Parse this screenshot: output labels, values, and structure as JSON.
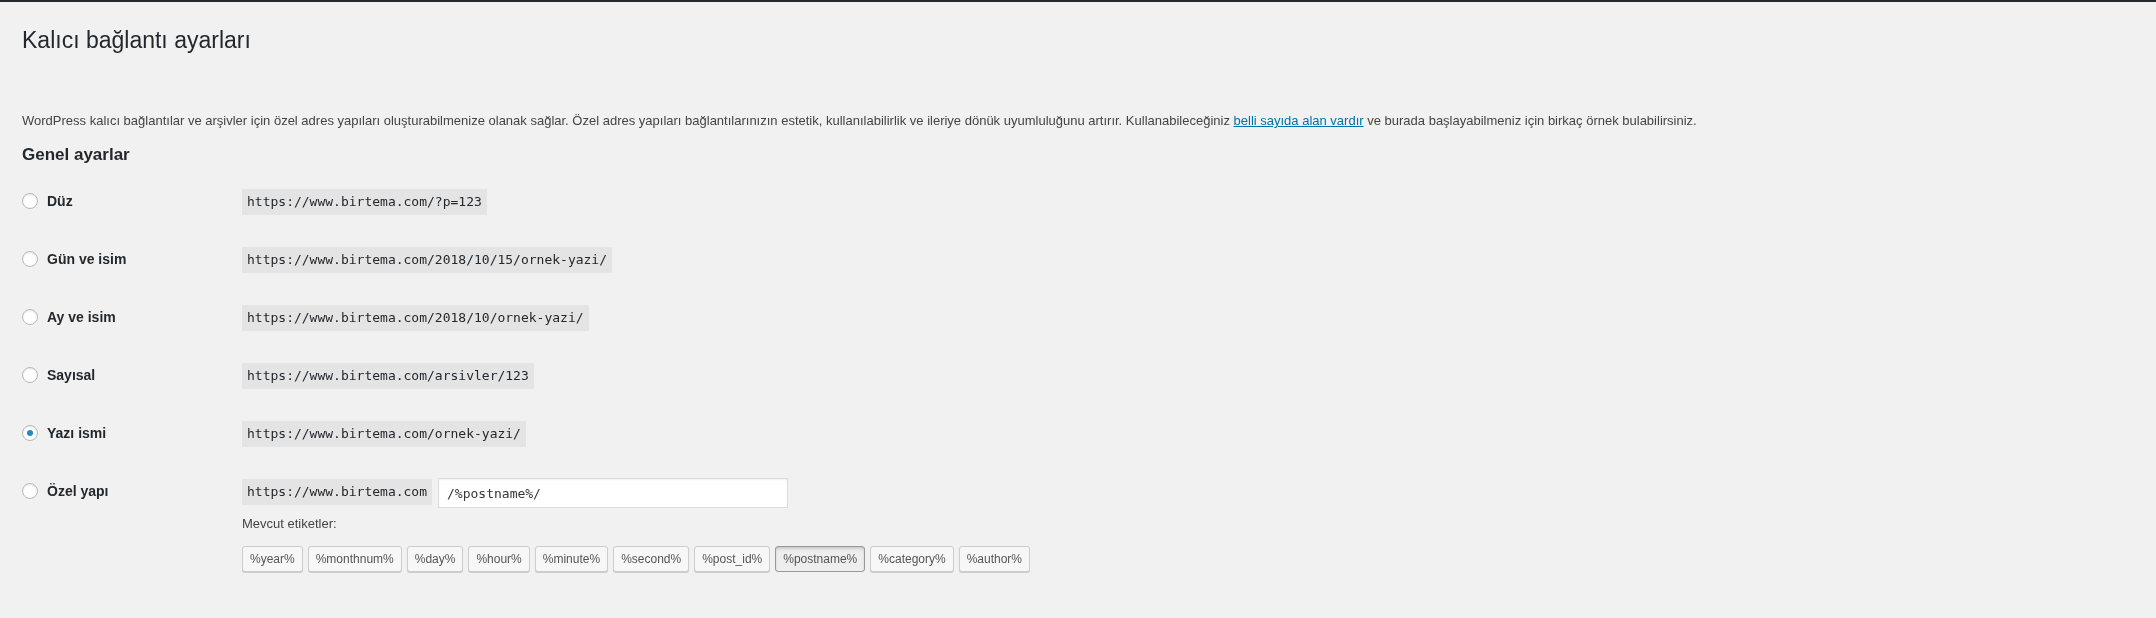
{
  "page_title": "Kalıcı bağlantı ayarları",
  "description": {
    "before": "WordPress kalıcı bağlantılar ve arşivler için özel adres yapıları oluşturabilmenize olanak sağlar. Özel adres yapıları bağlantılarınızın estetik, kullanılabilirlik ve ileriye dönük uyumluluğunu artırır. Kullanabileceğiniz",
    "link": "belli sayıda alan vardır",
    "after": "ve burada başlayabilmeniz için birkaç örnek bulabilirsiniz."
  },
  "section_title": "Genel ayarlar",
  "options": [
    {
      "kind": "preset",
      "label": "Düz",
      "example": "https://www.birtema.com/?p=123",
      "selected": false
    },
    {
      "kind": "preset",
      "label": "Gün ve isim",
      "example": "https://www.birtema.com/2018/10/15/ornek-yazi/",
      "selected": false
    },
    {
      "kind": "preset",
      "label": "Ay ve isim",
      "example": "https://www.birtema.com/2018/10/ornek-yazi/",
      "selected": false
    },
    {
      "kind": "preset",
      "label": "Sayısal",
      "example": "https://www.birtema.com/arsivler/123",
      "selected": false
    },
    {
      "kind": "preset",
      "label": "Yazı ismi",
      "example": "https://www.birtema.com/ornek-yazi/",
      "selected": true
    },
    {
      "kind": "custom",
      "label": "Özel yapı",
      "example": "https://www.birtema.com",
      "value": "/%postname%/",
      "selected": false
    }
  ],
  "available_tags": {
    "label": "Mevcut etiketler:",
    "tags": [
      {
        "text": "%year%",
        "selected": false
      },
      {
        "text": "%monthnum%",
        "selected": false
      },
      {
        "text": "%day%",
        "selected": false
      },
      {
        "text": "%hour%",
        "selected": false
      },
      {
        "text": "%minute%",
        "selected": false
      },
      {
        "text": "%second%",
        "selected": false
      },
      {
        "text": "%post_id%",
        "selected": false
      },
      {
        "text": "%postname%",
        "selected": true
      },
      {
        "text": "%category%",
        "selected": false
      },
      {
        "text": "%author%",
        "selected": false
      }
    ]
  }
}
